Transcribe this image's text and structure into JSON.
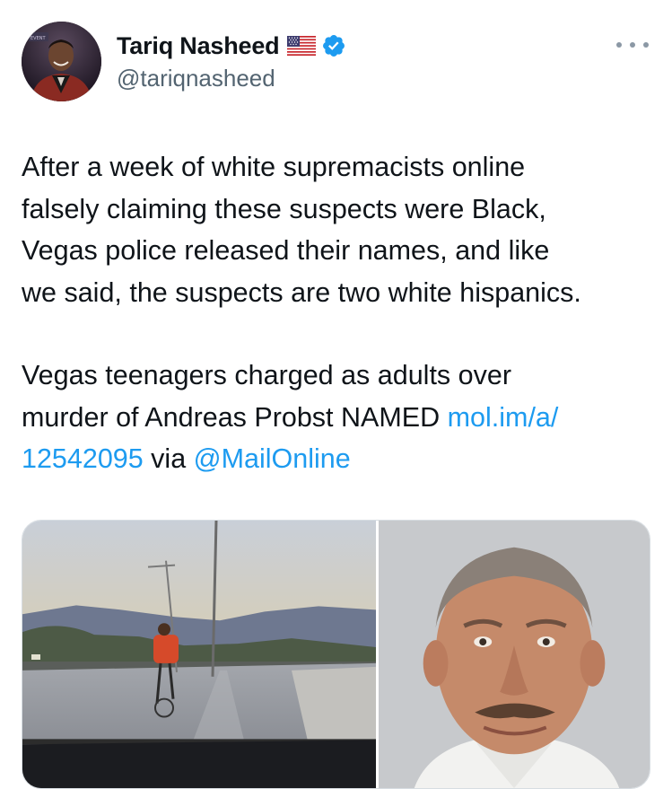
{
  "author": {
    "display_name": "Tariq Nasheed",
    "flag_emoji": "🇺🇸",
    "handle": "@tariqnasheed",
    "verified_color": "#1d9bf0"
  },
  "tweet": {
    "paragraph1": "After a week of white supremacists online\nfalsely claiming these suspects were Black,\nVegas police released their names, and like\nwe said, the suspects are two white hispanics.",
    "paragraph2_text": "Vegas teenagers charged as adults over\nmurder of Andreas Probst NAMED ",
    "link_url": "mol.im/a/\n12542095",
    "via_text": " via ",
    "mention": "@MailOnline"
  },
  "icons": {
    "avatar": "avatar",
    "flag": "us-flag-icon",
    "verified": "verified-badge-icon",
    "more": "more-options-icon"
  },
  "colors": {
    "link": "#1d9bf0",
    "secondary_text": "#536471",
    "primary_text": "#0f1419"
  }
}
